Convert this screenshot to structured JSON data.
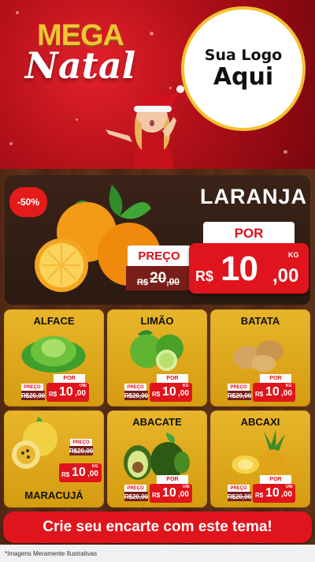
{
  "header": {
    "title_line1": "MEGA",
    "title_line2": "Natal",
    "logo_line1": "Sua Logo",
    "logo_line2": "Aqui"
  },
  "featured": {
    "discount": "-50%",
    "name": "LARANJA",
    "por_label": "POR",
    "preco_label": "PREÇO",
    "old_currency": "R$",
    "old_int": "20",
    "old_dec": ",00",
    "currency": "R$",
    "price_int": "10",
    "price_dec": ",00",
    "unit": "KG"
  },
  "products": [
    {
      "name": "ALFACE",
      "preco_label": "PREÇO",
      "old": "R$20,00",
      "por_label": "POR",
      "currency": "R$",
      "price_int": "10",
      "price_dec": ",00",
      "unit": "UNI"
    },
    {
      "name": "LIMÃO",
      "preco_label": "PREÇO",
      "old": "R$20,00",
      "por_label": "POR",
      "currency": "R$",
      "price_int": "10",
      "price_dec": ",00",
      "unit": "KG"
    },
    {
      "name": "BATATA",
      "preco_label": "PREÇO",
      "old": "R$20,00",
      "por_label": "POR",
      "currency": "R$",
      "price_int": "10",
      "price_dec": ",00",
      "unit": "KG"
    },
    {
      "name": "MARACUJÁ",
      "preco_label": "PREÇO",
      "old": "R$20,00",
      "por_label": "POR",
      "currency": "R$",
      "price_int": "10",
      "price_dec": ",00",
      "unit": "KG"
    },
    {
      "name": "ABACATE",
      "preco_label": "PREÇO",
      "old": "R$20,00",
      "por_label": "POR",
      "currency": "R$",
      "price_int": "10",
      "price_dec": ",00",
      "unit": "UNI"
    },
    {
      "name": "ABCAXI",
      "preco_label": "PREÇO",
      "old": "R$20,00",
      "por_label": "POR",
      "currency": "R$",
      "price_int": "10",
      "price_dec": ",00",
      "unit": "UNI"
    }
  ],
  "cta": "Crie seu encarte com este tema!",
  "footnote": "*Imagens Meramente Ilustrativas",
  "colors": {
    "red": "#e0141c",
    "gold": "#e8b52a",
    "wood": "#5a2e17"
  }
}
